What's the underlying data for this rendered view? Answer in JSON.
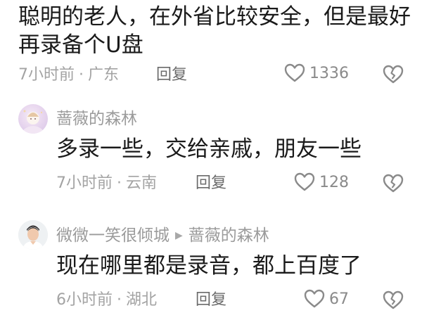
{
  "comments": [
    {
      "text_line1": "聪明的老人，在外省比较安全，但是最好",
      "text_line2": "再录备个U盘",
      "time": "7小时前",
      "location": "广东",
      "reply_label": "回复",
      "likes": "1336"
    },
    {
      "username": "蔷薇的森林",
      "text": "多录一些，交给亲戚，朋友一些",
      "time": "7小时前",
      "location": "云南",
      "reply_label": "回复",
      "likes": "128"
    },
    {
      "username": "微微一笑很倾城",
      "reply_to": "蔷薇的森林",
      "text": "现在哪里都是录音，都上百度了",
      "time": "6小时前",
      "location": "湖北",
      "reply_label": "回复",
      "likes": "67"
    }
  ],
  "separator": "·",
  "icons": {
    "like": "heart-icon",
    "dislike": "broken-heart-icon",
    "reply_arrow": "triangle-right-icon"
  }
}
